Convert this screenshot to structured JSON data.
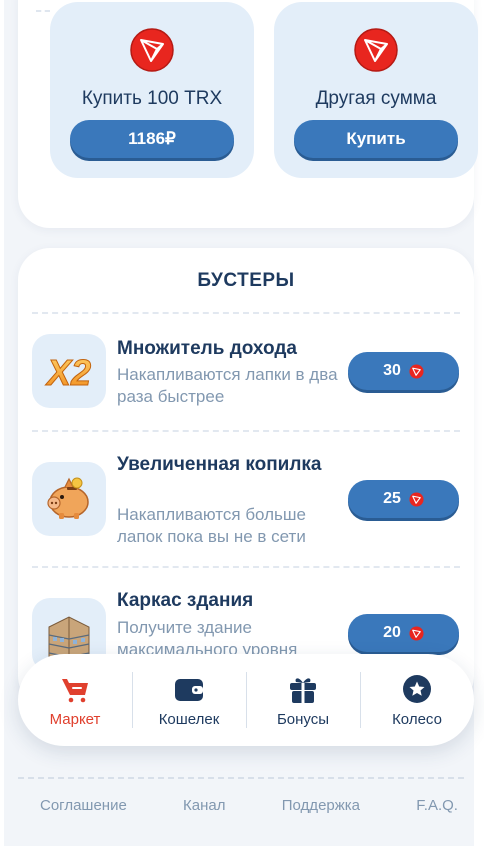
{
  "top_offers": [
    {
      "title": "Купить 100 TRX",
      "button_label": "1186₽",
      "icon": "tron-logo-icon"
    },
    {
      "title": "Другая сумма",
      "button_label": "Купить",
      "icon": "tron-logo-icon"
    }
  ],
  "boosters": {
    "title": "БУСТЕРЫ",
    "items": [
      {
        "icon": "x2-multiplier-icon",
        "name": "Множитель дохода",
        "description": "Накапливаются лапки в два раза быстрее",
        "price": "30",
        "currency_icon": "tron-logo-icon"
      },
      {
        "icon": "piggy-bank-icon",
        "name": "Увеличенная копилка",
        "description": "Накапливаются больше лапок пока вы не в сети",
        "price": "25",
        "currency_icon": "tron-logo-icon"
      },
      {
        "icon": "building-frame-icon",
        "name": "Каркас здания",
        "description": "Получите здание максимального уровня",
        "price": "20",
        "currency_icon": "tron-logo-icon"
      }
    ]
  },
  "bottom_nav": {
    "active": "Маркет",
    "items": [
      {
        "label": "Маркет",
        "icon": "cart-icon"
      },
      {
        "label": "Кошелек",
        "icon": "wallet-icon"
      },
      {
        "label": "Бонусы",
        "icon": "gift-icon"
      },
      {
        "label": "Колесо",
        "icon": "star-wheel-icon"
      }
    ]
  },
  "footer": {
    "links": [
      "Соглашение",
      "Канал",
      "Поддержка",
      "F.A.Q."
    ]
  },
  "colors": {
    "accent": "#3a78bb",
    "active_nav": "#e0402e",
    "tile_bg": "#e3eef9",
    "text": "#1e3a5f",
    "muted": "#8298b0"
  }
}
